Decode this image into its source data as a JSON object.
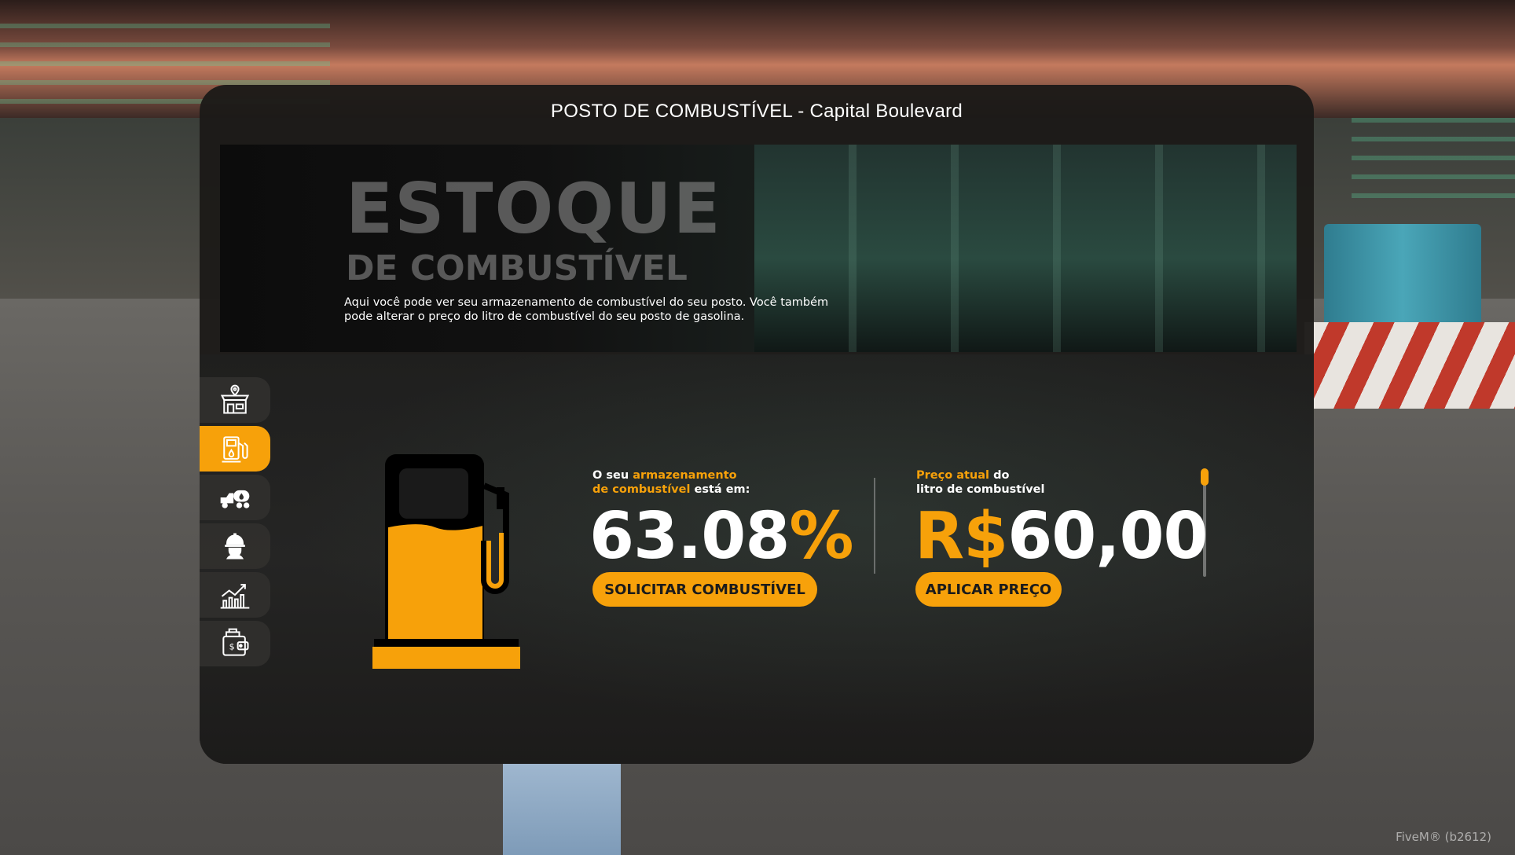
{
  "window": {
    "title": "POSTO DE COMBUSTÍVEL - Capital Boulevard",
    "watermark": "FiveM® (b2612)"
  },
  "banner": {
    "title_line1": "ESTOQUE",
    "title_line2": "DE COMBUSTÍVEL",
    "description": "Aqui você pode ver seu armazenamento de combustível do seu posto. Você também pode alterar o preço do litro de combustível do seu posto de gasolina."
  },
  "sidebar": {
    "items": [
      {
        "icon": "store-location-icon",
        "active": false
      },
      {
        "icon": "fuel-pump-icon",
        "active": true
      },
      {
        "icon": "tanker-truck-icon",
        "active": false
      },
      {
        "icon": "worker-helmet-icon",
        "active": false
      },
      {
        "icon": "growth-chart-icon",
        "active": false
      },
      {
        "icon": "wallet-money-icon",
        "active": false
      }
    ]
  },
  "storage": {
    "label_prefix": "O seu",
    "label_highlight_1": "armazenamento",
    "label_highlight_2": "de combustível",
    "label_suffix": "está em:",
    "value_number": "63.08",
    "value_symbol": "%",
    "fill_fraction": 0.6308,
    "button_label": "SOLICITAR COMBUSTÍVEL"
  },
  "price": {
    "label_highlight": "Preço atual",
    "label_suffix_1": "do",
    "label_line2": "litro de combustível",
    "currency": "R$",
    "value": "60,00",
    "button_label": "APLICAR PREÇO"
  },
  "colors": {
    "accent": "#f7a10a",
    "panel": "#1c1a18",
    "sidebar_button": "#302f2d"
  }
}
